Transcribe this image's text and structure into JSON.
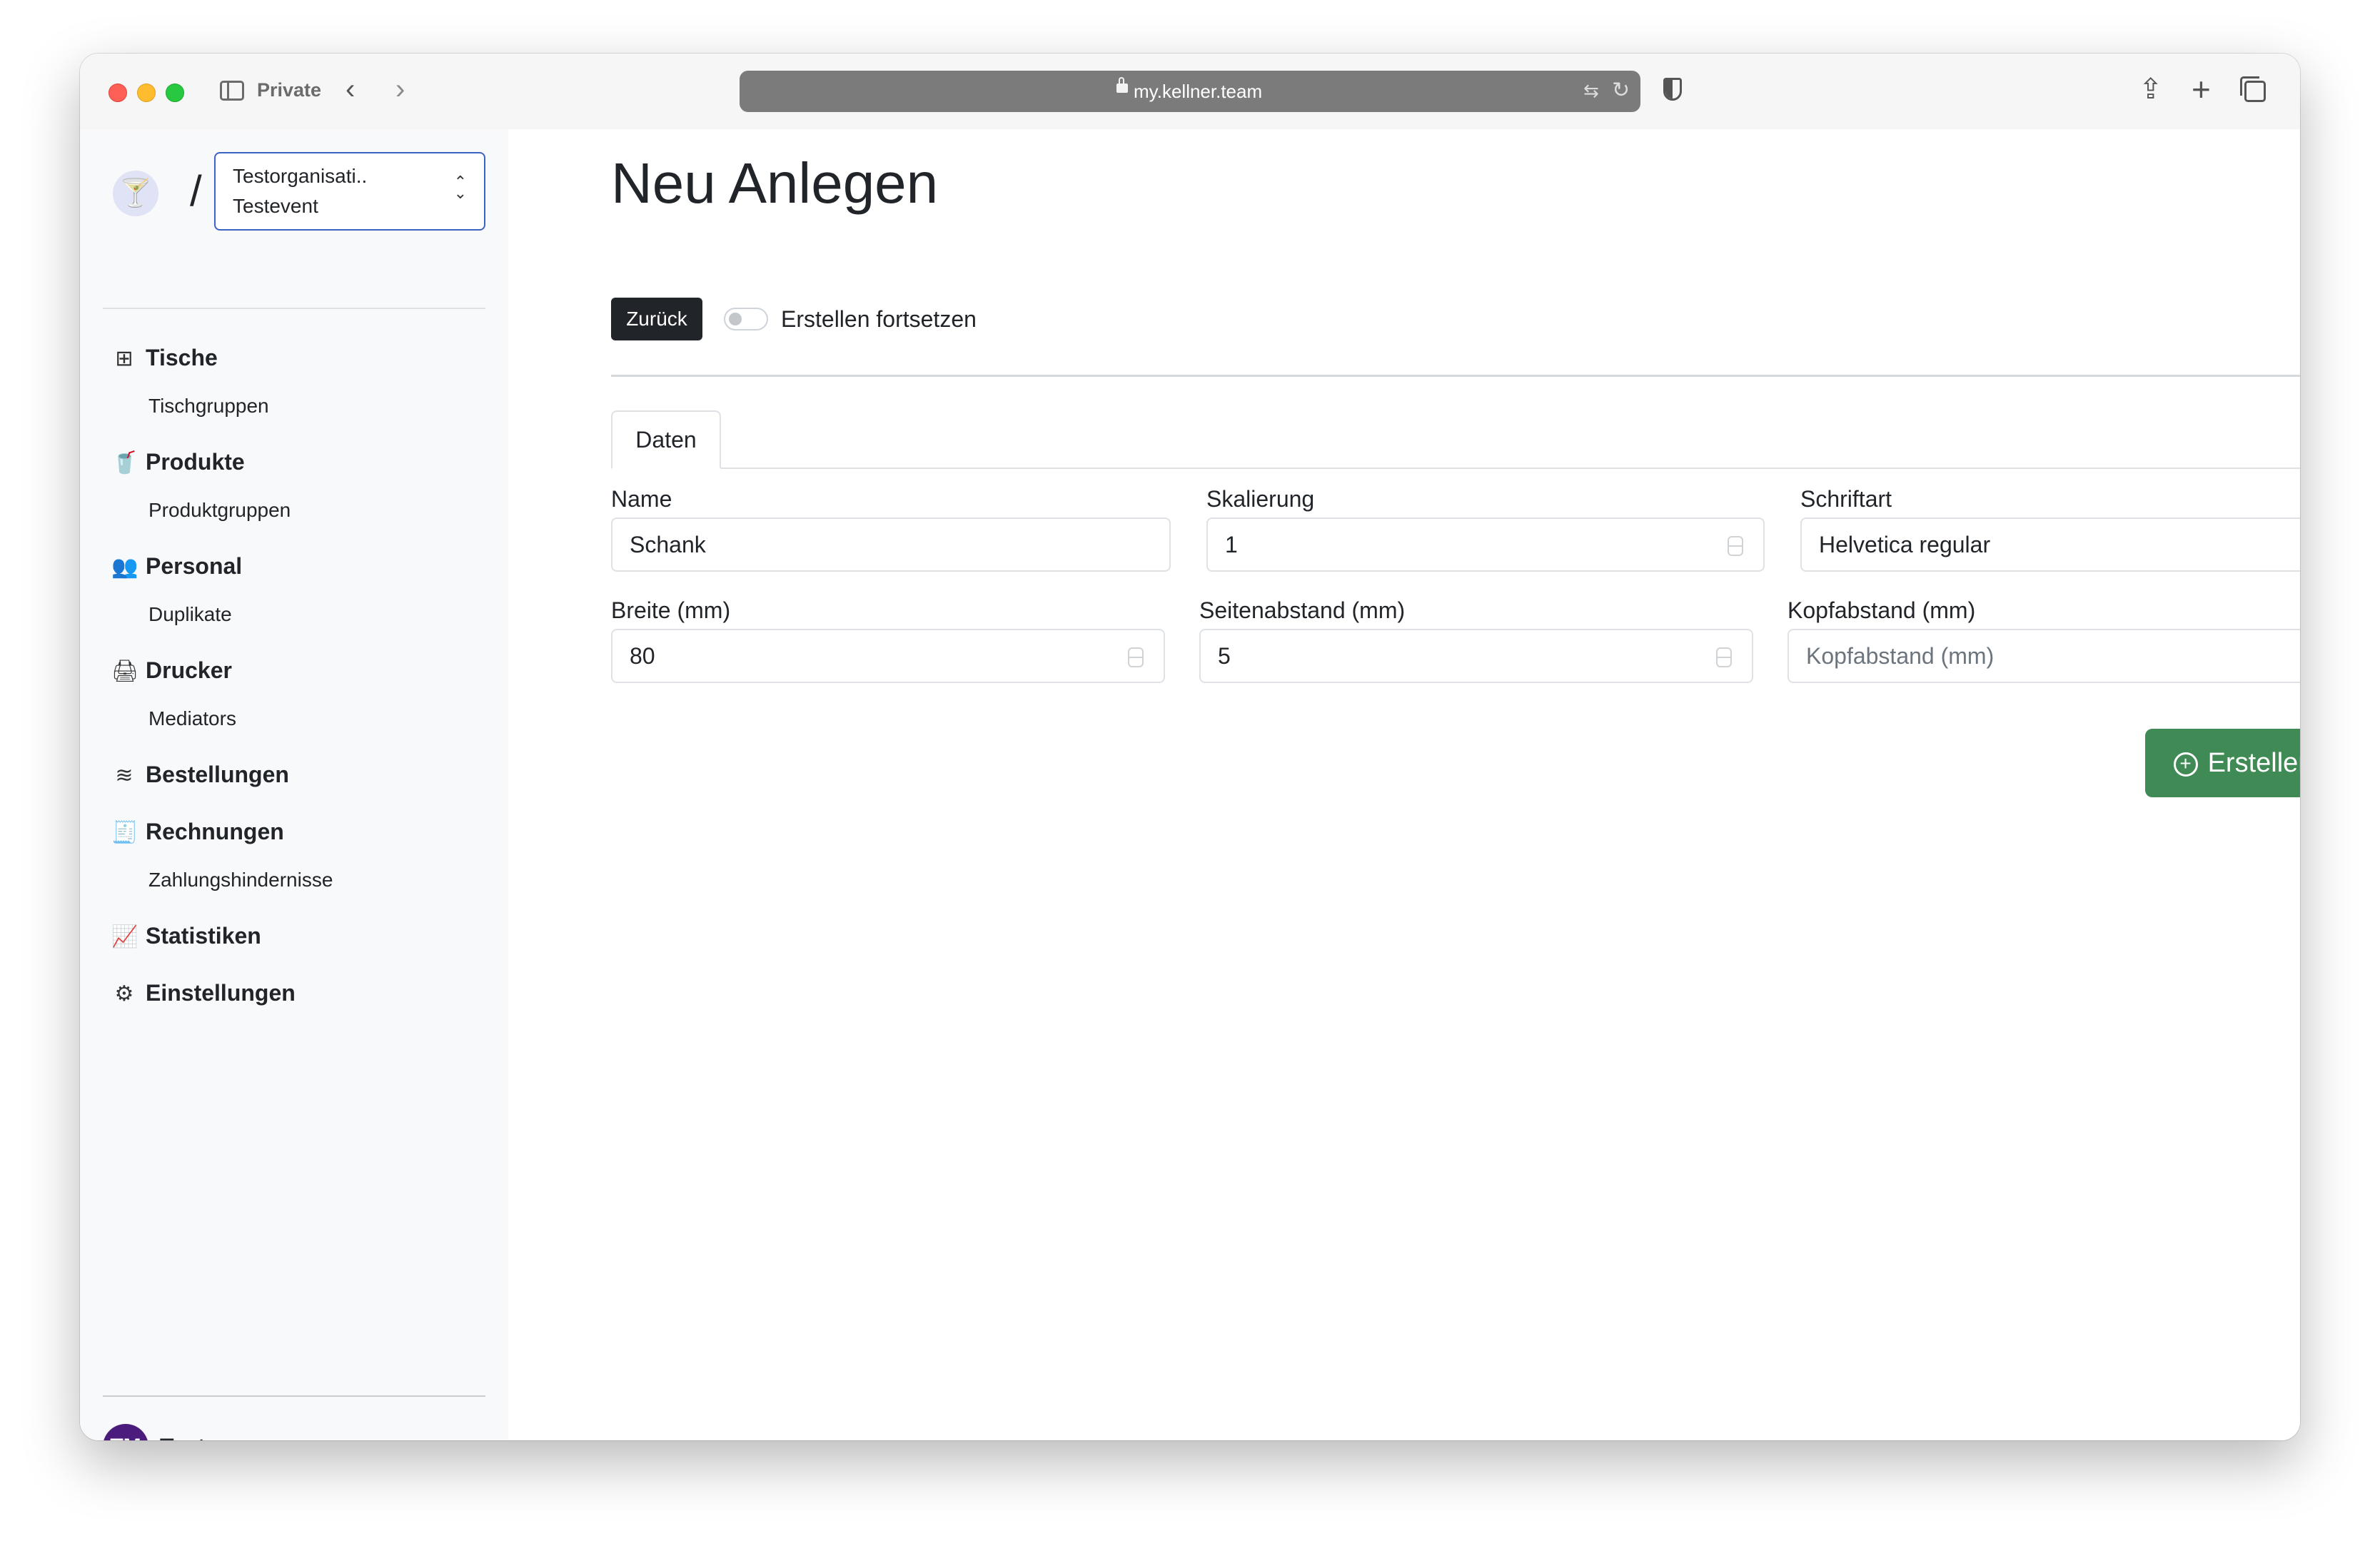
{
  "browser": {
    "private_label": "Private",
    "url": "my.kellner.team"
  },
  "sidebar": {
    "logo_glyph": "🍸",
    "separator": "/",
    "org": {
      "name": "Testorganisati..",
      "event": "Testevent"
    },
    "items": [
      {
        "label": "Tische",
        "icon": "grid-icon",
        "glyph": "⊞"
      },
      {
        "label": "Tischgruppen"
      },
      {
        "label": "Produkte",
        "icon": "cup-icon",
        "glyph": "🥤"
      },
      {
        "label": "Produktgruppen"
      },
      {
        "label": "Personal",
        "icon": "people-icon",
        "glyph": "👥"
      },
      {
        "label": "Duplikate"
      },
      {
        "label": "Drucker",
        "icon": "printer-icon",
        "glyph": "🖨"
      },
      {
        "label": "Mediators"
      },
      {
        "label": "Bestellungen",
        "icon": "layers-icon",
        "glyph": "≋"
      },
      {
        "label": "Rechnungen",
        "icon": "receipt-icon",
        "glyph": "🧾"
      },
      {
        "label": "Zahlungshindernisse"
      },
      {
        "label": "Statistiken",
        "icon": "chart-icon",
        "glyph": "📈"
      },
      {
        "label": "Einstellungen",
        "icon": "gear-icon",
        "glyph": "⚙"
      }
    ],
    "user": {
      "initials": "TM",
      "name": "Tester"
    }
  },
  "main": {
    "title": "Neu Anlegen",
    "back_label": "Zurück",
    "continue_label": "Erstellen fortsetzen",
    "tab_label": "Daten",
    "fields": {
      "name": {
        "label": "Name",
        "value": "Schank"
      },
      "scaling": {
        "label": "Skalierung",
        "value": "1"
      },
      "font": {
        "label": "Schriftart",
        "value": "Helvetica regular"
      },
      "width": {
        "label": "Breite (mm)",
        "value": "80"
      },
      "side_margin": {
        "label": "Seitenabstand (mm)",
        "value": "5"
      },
      "head_margin": {
        "label": "Kopfabstand (mm)",
        "placeholder": "Kopfabstand (mm)"
      }
    },
    "create_label": "Erstellen"
  }
}
